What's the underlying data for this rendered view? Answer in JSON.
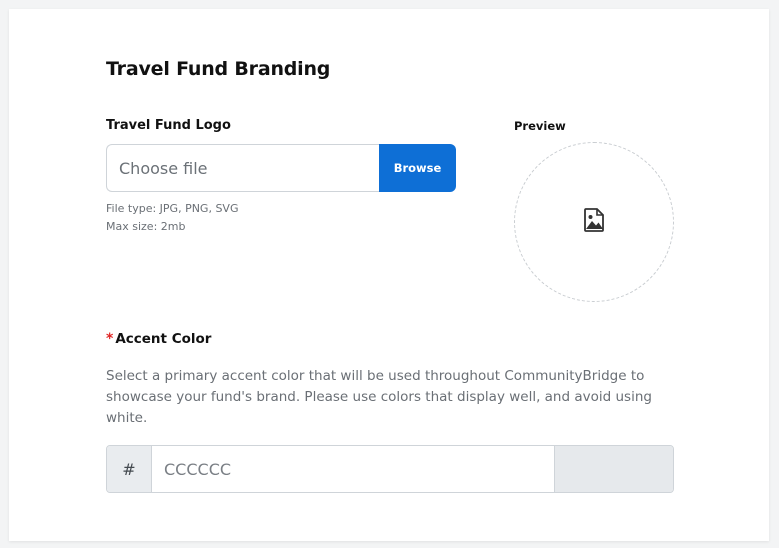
{
  "page": {
    "title": "Travel Fund Branding"
  },
  "logo": {
    "label": "Travel Fund Logo",
    "file_placeholder": "Choose file",
    "browse_label": "Browse",
    "file_type_hint": "File type: JPG, PNG, SVG",
    "max_size_hint": "Max size: 2mb",
    "preview_label": "Preview",
    "preview_icon": "image-icon"
  },
  "accent": {
    "required_marker": "*",
    "label": "Accent Color",
    "description": "Select a primary accent color that will be used throughout CommunityBridge to showcase your fund's brand. Please use colors that display well, and avoid using white.",
    "hash_prefix": "#",
    "value": "CCCCCC",
    "swatch_color": "#e6e9ec"
  },
  "colors": {
    "primary": "#0e6fd6",
    "required": "#e02424"
  }
}
